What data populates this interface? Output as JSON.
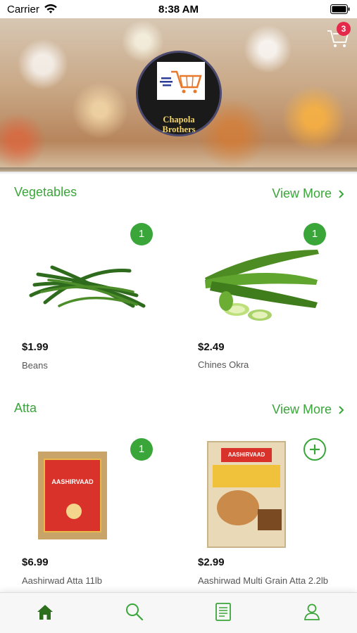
{
  "status_bar": {
    "carrier": "Carrier",
    "time": "8:38 AM"
  },
  "header": {
    "logo_line1": "Chapola",
    "logo_line2": "Brothers",
    "cart_count": "3"
  },
  "sections": [
    {
      "title": "Vegetables",
      "view_more": "View More",
      "products": [
        {
          "price": "$1.99",
          "name": "Beans",
          "badge": "1"
        },
        {
          "price": "$2.49",
          "name": "Chines Okra",
          "badge": "1"
        }
      ]
    },
    {
      "title": "Atta",
      "view_more": "View More",
      "products": [
        {
          "price": "$6.99",
          "name": "Aashirwad Atta 11lb",
          "badge": "1",
          "bag_brand": "AASHIRVAAD"
        },
        {
          "price": "$2.99",
          "name": "Aashirwad Multi Grain Atta 2.2lb",
          "badge": "",
          "bag_brand": "AASHIRVAAD"
        }
      ]
    }
  ],
  "tab_bar": {
    "items": [
      {
        "icon": "home-icon",
        "active": true
      },
      {
        "icon": "search-icon",
        "active": false
      },
      {
        "icon": "orders-icon",
        "active": false
      },
      {
        "icon": "profile-icon",
        "active": false
      }
    ]
  },
  "colors": {
    "accent": "#3aa63a",
    "badge_red": "#e5294a",
    "logo_gold": "#f1d36a"
  }
}
